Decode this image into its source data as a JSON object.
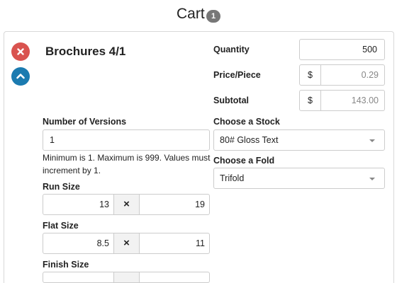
{
  "header": {
    "title": "Cart",
    "badge": "1"
  },
  "item": {
    "name": "Brochures 4/1"
  },
  "icons": {
    "remove": "close-icon",
    "collapse": "chevron-up-icon"
  },
  "colors": {
    "remove": "#d9534f",
    "collapse": "#1b7bb0",
    "badge": "#777777"
  },
  "pricing": {
    "quantity_label": "Quantity",
    "quantity_value": "500",
    "price_label": "Price/Piece",
    "price_currency": "$",
    "price_value": "0.29",
    "subtotal_label": "Subtotal",
    "subtotal_currency": "$",
    "subtotal_value": "143.00"
  },
  "versions": {
    "label": "Number of Versions",
    "value": "1",
    "help": "Minimum is 1. Maximum is 999. Values must increment by 1."
  },
  "run_size": {
    "label": "Run Size",
    "width": "13",
    "separator": "×",
    "height": "19"
  },
  "flat_size": {
    "label": "Flat Size",
    "width": "8.5",
    "separator": "×",
    "height": "11"
  },
  "finish_size": {
    "label": "Finish Size"
  },
  "stock": {
    "label": "Choose a Stock",
    "selected": "80# Gloss Text"
  },
  "fold": {
    "label": "Choose a Fold",
    "selected": "Trifold"
  }
}
